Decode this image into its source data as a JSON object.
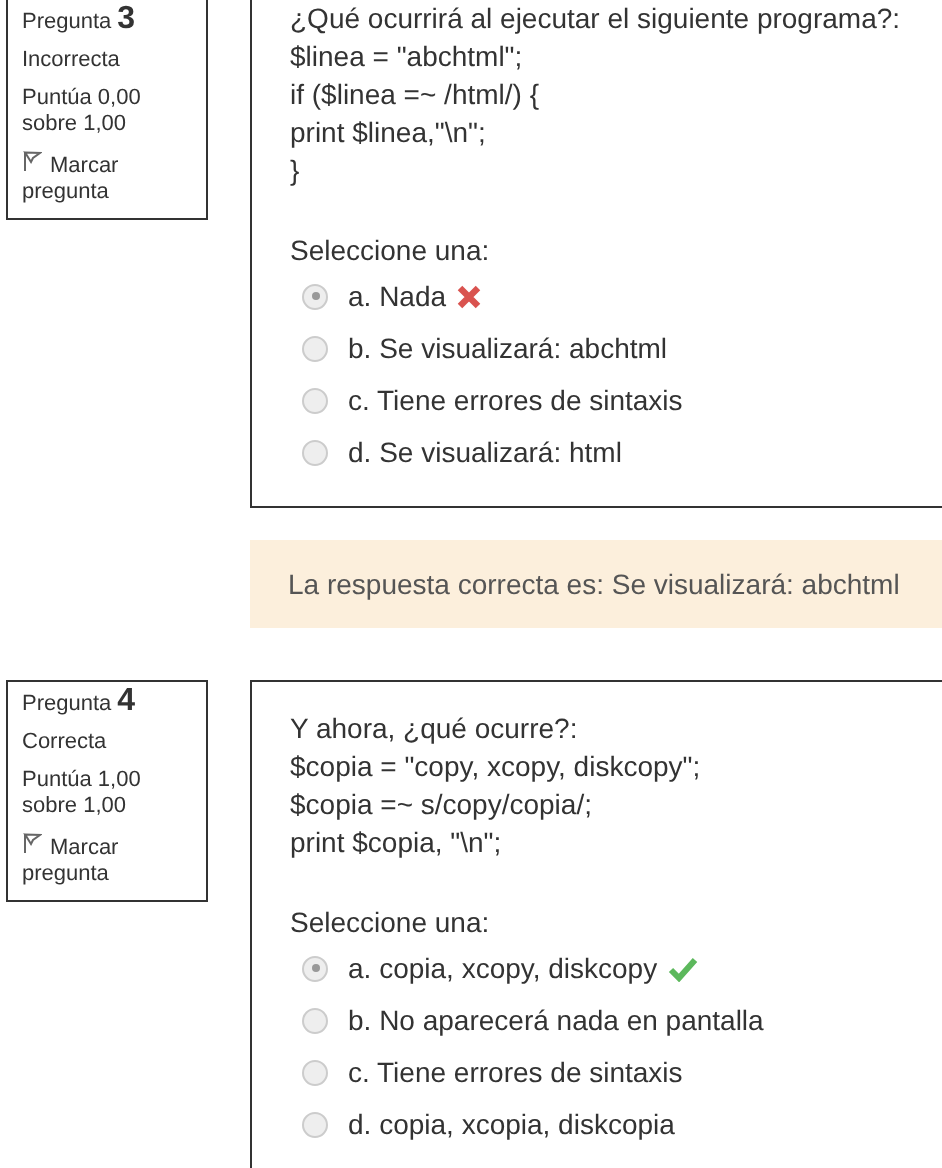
{
  "questions": [
    {
      "label": "Pregunta",
      "number": "3",
      "state": "Incorrecta",
      "grade": "Puntúa 0,00 sobre 1,00",
      "flag": "Marcar pregunta",
      "lines": [
        "¿Qué ocurrirá al ejecutar el siguiente programa?:",
        "$linea = \"abchtml\";",
        "if ($linea =~ /html/) {",
        "print $linea,\"\\n\";",
        "}"
      ],
      "prompt": "Seleccione una:",
      "options": [
        {
          "label": "a. Nada",
          "selected": true,
          "kind": "incorrect"
        },
        {
          "label": "b. Se visualizará: abchtml",
          "selected": false,
          "kind": "plain"
        },
        {
          "label": "c. Tiene errores de sintaxis",
          "selected": false,
          "kind": "plain"
        },
        {
          "label": "d. Se visualizará: html",
          "selected": false,
          "kind": "plain"
        }
      ],
      "feedback": "La respuesta correcta es: Se visualizará: abchtml"
    },
    {
      "label": "Pregunta",
      "number": "4",
      "state": "Correcta",
      "grade": "Puntúa 1,00 sobre 1,00",
      "flag": "Marcar pregunta",
      "lines": [
        "Y ahora, ¿qué ocurre?:",
        "$copia = \"copy, xcopy, diskcopy\";",
        "$copia =~ s/copy/copia/;",
        "print $copia, \"\\n\";"
      ],
      "prompt": "Seleccione una:",
      "options": [
        {
          "label": "a. copia, xcopy, diskcopy",
          "selected": true,
          "kind": "correct"
        },
        {
          "label": "b. No aparecerá nada en pantalla",
          "selected": false,
          "kind": "plain"
        },
        {
          "label": "c. Tiene errores de sintaxis",
          "selected": false,
          "kind": "plain"
        },
        {
          "label": "d. copia, xcopia, diskcopia",
          "selected": false,
          "kind": "plain"
        }
      ]
    }
  ]
}
